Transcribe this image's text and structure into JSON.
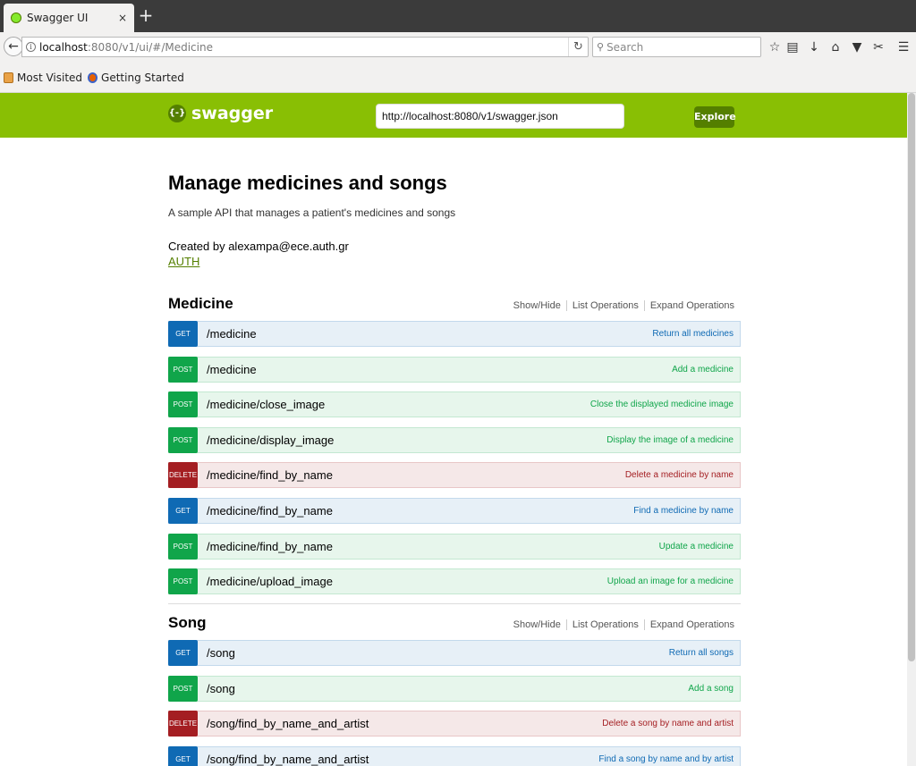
{
  "browser": {
    "tab_title": "Swagger UI",
    "tab_close": "×",
    "new_tab": "+",
    "url_host": "localhost",
    "url_path": ":8080/v1/ui/#/Medicine",
    "search_placeholder": "Search",
    "bookmarks": [
      "Most Visited",
      "Getting Started"
    ]
  },
  "swagger": {
    "logo_text": "swagger",
    "api_url": "http://localhost:8080/v1/swagger.json",
    "explore_label": "Explore"
  },
  "info": {
    "title": "Manage medicines and songs",
    "description": "A sample API that manages a patient's medicines and songs",
    "contact": "Created by alexampa@ece.auth.gr",
    "license": "AUTH"
  },
  "resource_links": [
    "Show/Hide",
    "List Operations",
    "Expand Operations"
  ],
  "resources": [
    {
      "name": "Medicine",
      "operations": [
        {
          "method": "get",
          "verb": "GET",
          "path": "/medicine",
          "summary": "Return all medicines"
        },
        {
          "method": "post",
          "verb": "POST",
          "path": "/medicine",
          "summary": "Add a medicine"
        },
        {
          "method": "post",
          "verb": "POST",
          "path": "/medicine/close_image",
          "summary": "Close the displayed medicine image"
        },
        {
          "method": "post",
          "verb": "POST",
          "path": "/medicine/display_image",
          "summary": "Display the image of a medicine"
        },
        {
          "method": "delete",
          "verb": "DELETE",
          "path": "/medicine/find_by_name",
          "summary": "Delete a medicine by name"
        },
        {
          "method": "get",
          "verb": "GET",
          "path": "/medicine/find_by_name",
          "summary": "Find a medicine by name"
        },
        {
          "method": "post",
          "verb": "POST",
          "path": "/medicine/find_by_name",
          "summary": "Update a medicine"
        },
        {
          "method": "post",
          "verb": "POST",
          "path": "/medicine/upload_image",
          "summary": "Upload an image for a medicine"
        }
      ]
    },
    {
      "name": "Song",
      "operations": [
        {
          "method": "get",
          "verb": "GET",
          "path": "/song",
          "summary": "Return all songs"
        },
        {
          "method": "post",
          "verb": "POST",
          "path": "/song",
          "summary": "Add a song"
        },
        {
          "method": "delete",
          "verb": "DELETE",
          "path": "/song/find_by_name_and_artist",
          "summary": "Delete a song by name and artist"
        },
        {
          "method": "get",
          "verb": "GET",
          "path": "/song/find_by_name_and_artist",
          "summary": "Find a song by name and by artist"
        }
      ]
    }
  ],
  "colors": {
    "swagger_green": "#89bf04",
    "get": "#0f6ab4",
    "post": "#10a54a",
    "delete": "#a41e22"
  }
}
